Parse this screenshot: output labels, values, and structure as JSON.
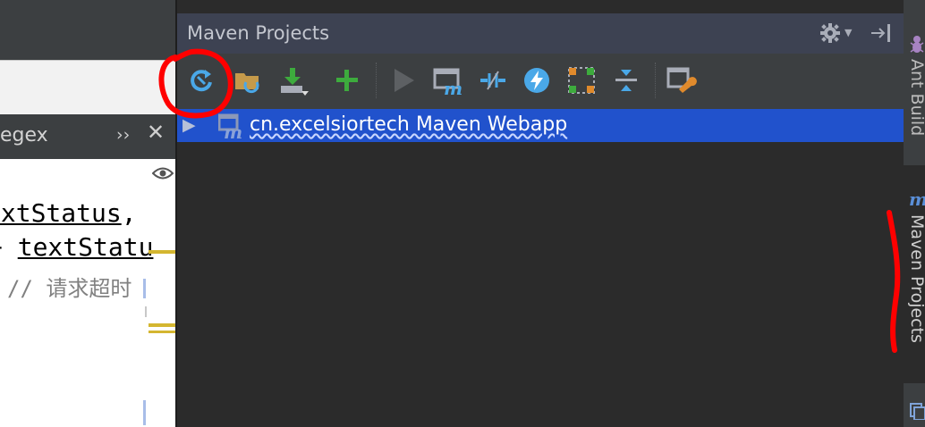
{
  "left_panel": {
    "tab_label": "egex",
    "overflow_label": "››",
    "close_label": "✕",
    "code_lines": [
      {
        "a": "extStatus",
        "b": ","
      },
      {
        "a": "+ ",
        "b": "textStatu"
      },
      {
        "a": "// 请求超时"
      }
    ]
  },
  "maven": {
    "title": "Maven Projects",
    "toolbar": [
      "reimport-icon",
      "generate-sources-icon",
      "download-icon",
      "add-project-icon",
      "run-icon",
      "execute-goal-icon",
      "toggle-offline-icon",
      "skip-tests-icon",
      "show-dependencies-icon",
      "collapse-all-icon",
      "settings-wrench-icon"
    ],
    "tree": {
      "project": "cn.excelsiortech Maven Webapp"
    }
  },
  "side_tabs": {
    "ant": "Ant Build",
    "maven": "Maven Projects"
  },
  "colors": {
    "header": "#3d4252",
    "selection": "#2152cc",
    "accent_blue": "#4aa8e8",
    "green": "#3dab3d",
    "annotation": "#ff0000"
  }
}
